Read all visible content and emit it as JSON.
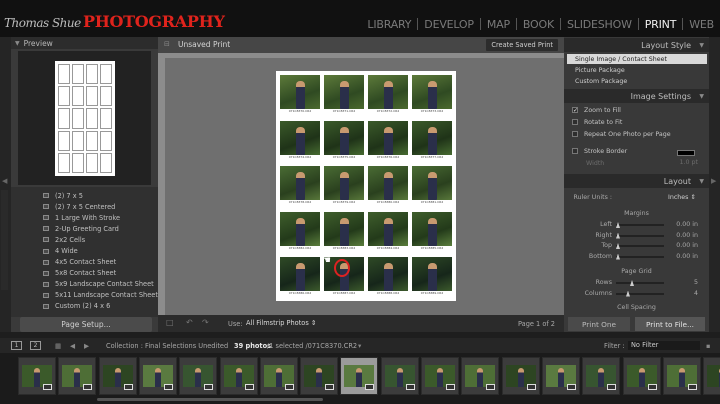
{
  "identity": {
    "name": "Thomas Shue",
    "brand": "PHOTOGRAPHY"
  },
  "modules": [
    "LIBRARY",
    "DEVELOP",
    "MAP",
    "BOOK",
    "SLIDESHOW",
    "PRINT",
    "WEB"
  ],
  "active_module": "PRINT",
  "left_panel": {
    "preview_header": "Preview",
    "templates": [
      "(2) 7 x 5",
      "(2) 7 x 5 Centered",
      "1 Large With Stroke",
      "2-Up Greeting Card",
      "2x2 Cells",
      "4 Wide",
      "4x5 Contact Sheet",
      "5x8 Contact Sheet",
      "5x9 Landscape Contact Sheet",
      "5x11 Landscape Contact Sheet",
      "Custom (2) 4 x 6"
    ],
    "page_setup_label": "Page Setup..."
  },
  "center": {
    "title": "Unsaved Print",
    "save_button": "Create Saved Print",
    "use_label": "Use:",
    "use_value": "All Filmstrip Photos",
    "page_label": "Page 1 of 2",
    "cell_captions": [
      "071C8370.CR2",
      "071C8371.CR2",
      "071C8372.CR2",
      "071C8373.CR2",
      "071C8374.CR2",
      "071C8375.CR2",
      "071C8376.CR2",
      "071C8377.CR2",
      "071C8378.CR2",
      "071C8379.CR2",
      "071C8380.CR2",
      "071C8381.CR2",
      "071C8382.CR2",
      "071C8383.CR2",
      "071C8384.CR2",
      "071C8385.CR2",
      "071C8386.CR2",
      "071C8387.CR2",
      "071C8388.CR2",
      "071C8389.CR2"
    ]
  },
  "right_panel": {
    "layout_style_header": "Layout Style",
    "layout_styles": [
      "Single Image / Contact Sheet",
      "Picture Package",
      "Custom Package"
    ],
    "image_settings_header": "Image Settings",
    "image_settings": [
      {
        "label": "Zoom to Fill",
        "checked": true
      },
      {
        "label": "Rotate to Fit",
        "checked": false
      },
      {
        "label": "Repeat One Photo per Page",
        "checked": false
      },
      {
        "label": "Stroke Border",
        "checked": false
      }
    ],
    "width_label": "Width",
    "width_value": "1.0 pt",
    "layout_header": "Layout",
    "ruler_units_label": "Ruler Units :",
    "ruler_units_value": "Inches",
    "margins_label": "Margins",
    "margins": [
      {
        "label": "Left",
        "value": "0.00 in"
      },
      {
        "label": "Right",
        "value": "0.00 in"
      },
      {
        "label": "Top",
        "value": "0.00 in"
      },
      {
        "label": "Bottom",
        "value": "0.00 in"
      }
    ],
    "page_grid_label": "Page Grid",
    "grid": [
      {
        "label": "Rows",
        "value": "5"
      },
      {
        "label": "Columns",
        "value": "4"
      }
    ],
    "cell_spacing_label": "Cell Spacing",
    "print_one": "Print One",
    "print_to_file": "Print to File..."
  },
  "filmbar": {
    "monitor1": "1",
    "monitor2": "2",
    "collection": "Collection : Final Selections Unedited",
    "count": "39 photos",
    "selected": "/1 selected /071C8370.CR2",
    "filter_label": "Filter :",
    "filter_value": "No Filter"
  },
  "filmstrip_count": 18,
  "filmstrip_selected_index": 8,
  "colors": {
    "brand_red": "#e0231c",
    "active_module": "#f0f0f0",
    "selected_style": "#d9d9d9"
  }
}
